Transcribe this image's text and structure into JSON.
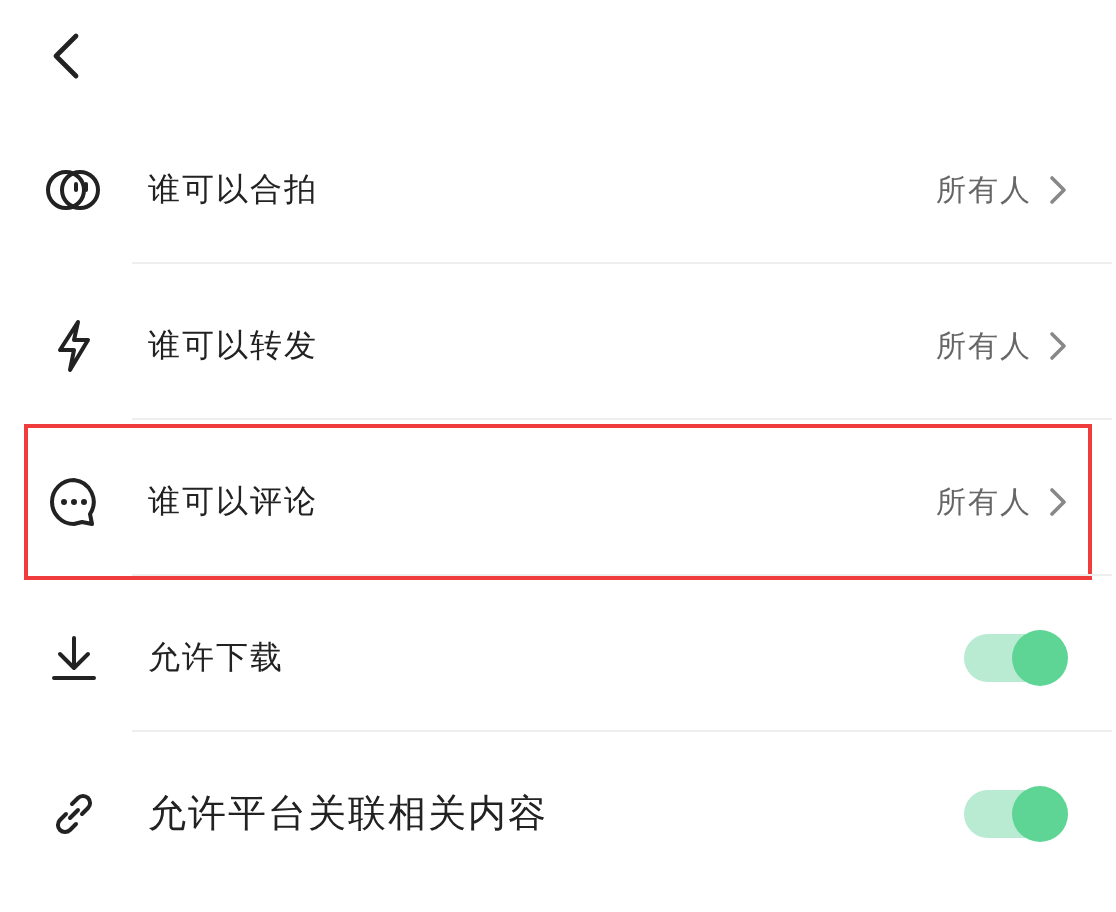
{
  "rows": [
    {
      "kind": "choice",
      "label": "谁可以合拍",
      "value": "所有人",
      "highlighted": false
    },
    {
      "kind": "choice",
      "label": "谁可以转发",
      "value": "所有人",
      "highlighted": false
    },
    {
      "kind": "choice",
      "label": "谁可以评论",
      "value": "所有人",
      "highlighted": true
    },
    {
      "kind": "toggle",
      "label": "允许下载",
      "on": true,
      "highlighted": false
    },
    {
      "kind": "toggle",
      "label": "允许平台关联相关内容",
      "on": true,
      "highlighted": false
    }
  ]
}
